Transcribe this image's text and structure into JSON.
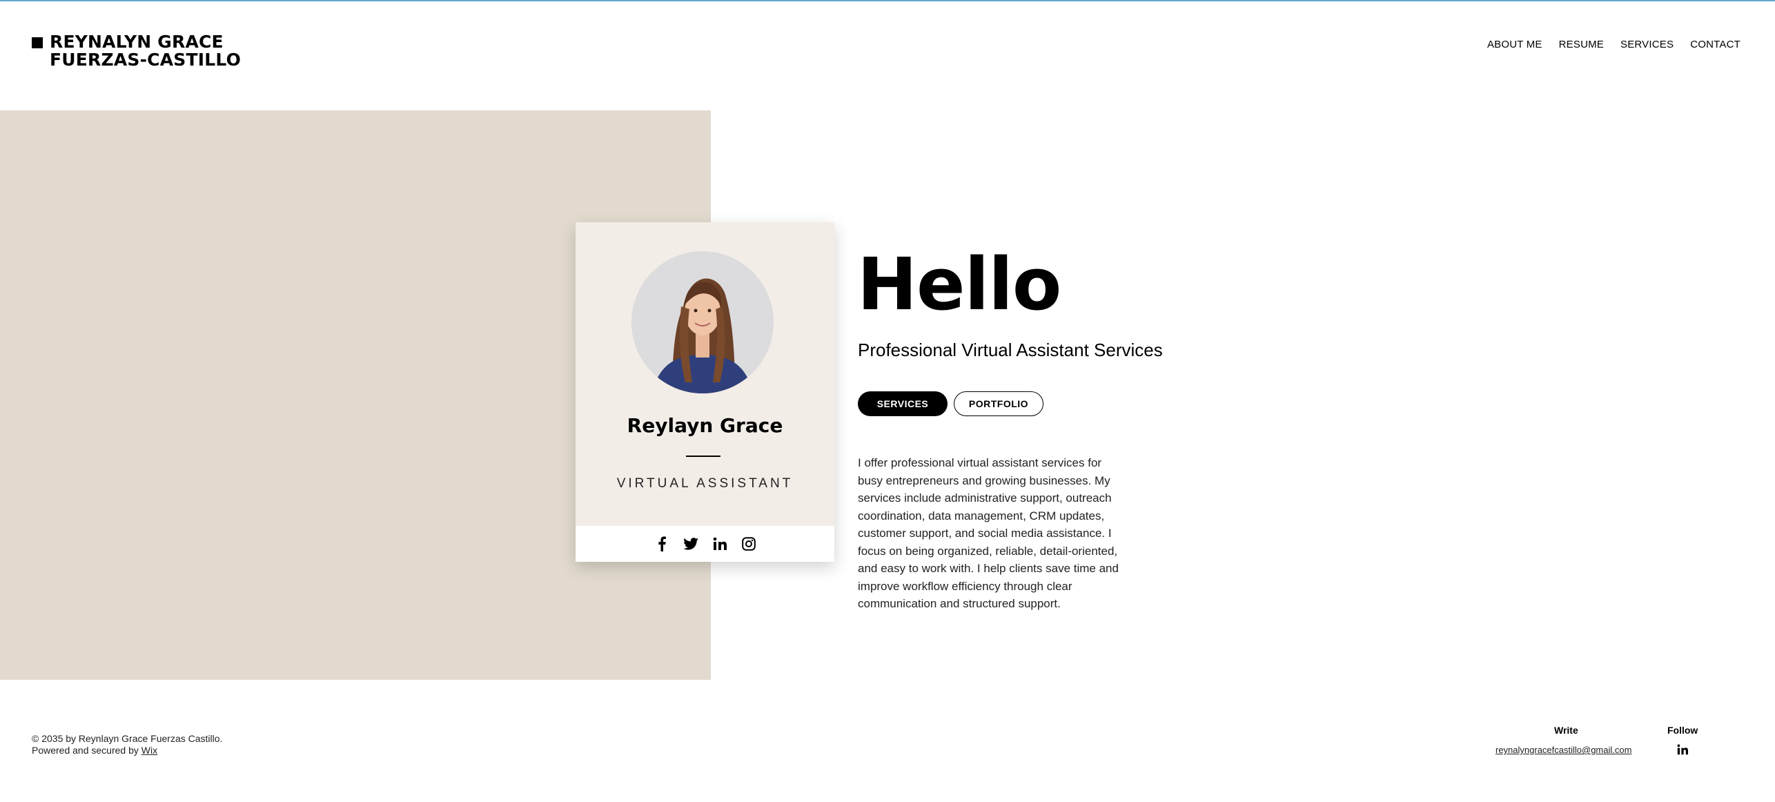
{
  "header": {
    "logo_line1": "REYNALYN GRACE",
    "logo_line2": "FUERZAS-CASTILLO",
    "nav": [
      "ABOUT ME",
      "RESUME",
      "SERVICES",
      "CONTACT"
    ]
  },
  "card": {
    "name": "Reylayn Grace",
    "role": "VIRTUAL ASSISTANT",
    "social_icons": [
      "facebook-icon",
      "twitter-icon",
      "linkedin-icon",
      "instagram-icon"
    ]
  },
  "hero": {
    "heading": "Hello",
    "subtitle": "Professional Virtual Assistant Services",
    "button_services": "SERVICES",
    "button_portfolio": "PORTFOLIO",
    "bio": "I offer professional virtual assistant services for busy entrepreneurs and growing businesses. My services include administrative support, outreach coordination, data management, CRM updates, customer support, and social media assistance. I focus on being organized, reliable, detail-oriented, and easy to work with. I help clients save time and improve workflow efficiency through clear communication and structured support."
  },
  "footer": {
    "copyright_line1": "© 2035 by Reynlayn Grace Fuerzas Castillo.",
    "copyright_line2_prefix": "Powered and secured by ",
    "copyright_link": "Wix",
    "write_title": "Write",
    "email": "reynalyngracefcastillo@gmail.com",
    "follow_title": "Follow",
    "follow_icon": "linkedin-icon"
  },
  "colors": {
    "beige_block": "#e2dace",
    "card_background": "#f3ede8",
    "accent_line": "#5fa8c9"
  }
}
